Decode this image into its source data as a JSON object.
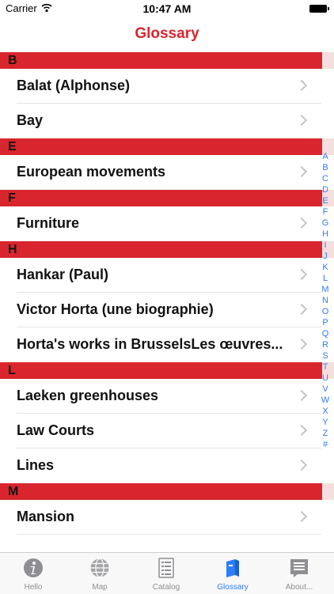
{
  "status_bar": {
    "carrier": "Carrier",
    "time": "10:47 AM"
  },
  "nav": {
    "title": "Glossary"
  },
  "sections": [
    {
      "letter": "B",
      "items": [
        "Balat (Alphonse)",
        "Bay"
      ]
    },
    {
      "letter": "E",
      "items": [
        "European movements"
      ]
    },
    {
      "letter": "F",
      "items": [
        "Furniture"
      ]
    },
    {
      "letter": "H",
      "items": [
        "Hankar (Paul)",
        "Victor Horta (une biographie)",
        "Horta's works in BrusselsLes œuvres..."
      ]
    },
    {
      "letter": "L",
      "items": [
        "Laeken greenhouses",
        "Law Courts",
        "Lines"
      ]
    },
    {
      "letter": "M",
      "items": [
        "Mansion"
      ]
    }
  ],
  "index_letters": [
    "A",
    "B",
    "C",
    "D",
    "E",
    "F",
    "G",
    "H",
    "I",
    "J",
    "K",
    "L",
    "M",
    "N",
    "O",
    "P",
    "Q",
    "R",
    "S",
    "T",
    "U",
    "V",
    "W",
    "X",
    "Y",
    "Z",
    "#"
  ],
  "tabs": [
    {
      "label": "Hello",
      "icon": "info-icon",
      "active": false
    },
    {
      "label": "Map",
      "icon": "globe-icon",
      "active": false
    },
    {
      "label": "Catalog",
      "icon": "document-icon",
      "active": false
    },
    {
      "label": "Glossary",
      "icon": "book-icon",
      "active": true
    },
    {
      "label": "About...",
      "icon": "bla-bla-apps-icon",
      "active": false
    }
  ],
  "colors": {
    "accent": "#d9252d",
    "tab_active": "#2f7df6",
    "tab_inactive": "#8e8e93"
  }
}
